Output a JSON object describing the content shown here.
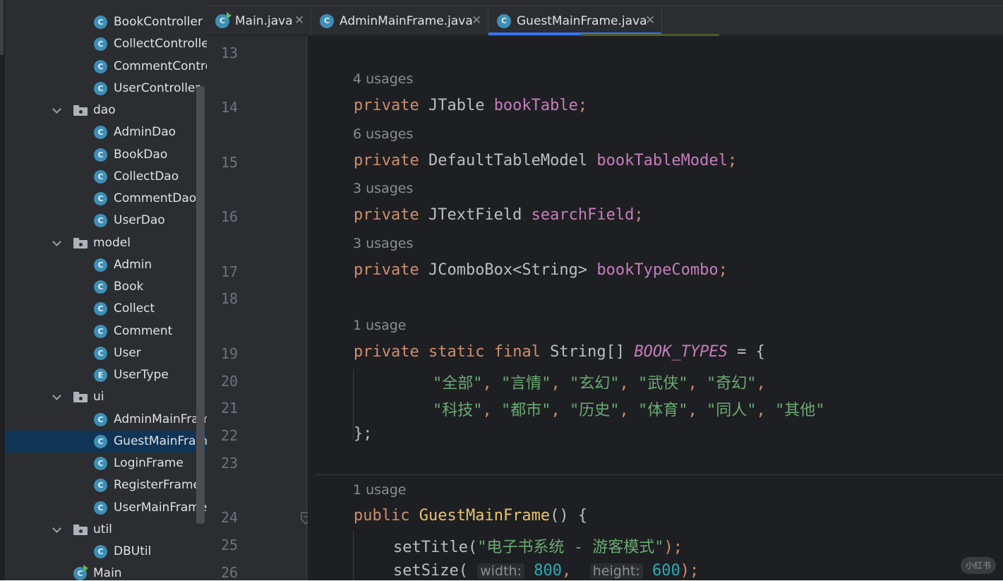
{
  "tabs": [
    {
      "label": "Main.java",
      "icon": "class-icon-main",
      "active": false
    },
    {
      "label": "AdminMainFrame.java",
      "icon": "class-icon",
      "active": false
    },
    {
      "label": "GuestMainFrame.java",
      "icon": "class-icon",
      "active": true
    }
  ],
  "tree": {
    "items": [
      {
        "label": "BookController",
        "kind": "class",
        "letter": "C"
      },
      {
        "label": "CollectControlle",
        "kind": "class",
        "letter": "C"
      },
      {
        "label": "CommentContro",
        "kind": "class",
        "letter": "C"
      },
      {
        "label": "UserController",
        "kind": "class",
        "letter": "C"
      },
      {
        "label": "dao",
        "kind": "package"
      },
      {
        "label": "AdminDao",
        "kind": "class",
        "letter": "C"
      },
      {
        "label": "BookDao",
        "kind": "class",
        "letter": "C"
      },
      {
        "label": "CollectDao",
        "kind": "class",
        "letter": "C"
      },
      {
        "label": "CommentDao",
        "kind": "class",
        "letter": "C"
      },
      {
        "label": "UserDao",
        "kind": "class",
        "letter": "C"
      },
      {
        "label": "model",
        "kind": "package"
      },
      {
        "label": "Admin",
        "kind": "class",
        "letter": "C"
      },
      {
        "label": "Book",
        "kind": "class",
        "letter": "C"
      },
      {
        "label": "Collect",
        "kind": "class",
        "letter": "C"
      },
      {
        "label": "Comment",
        "kind": "class",
        "letter": "C"
      },
      {
        "label": "User",
        "kind": "class",
        "letter": "C"
      },
      {
        "label": "UserType",
        "kind": "enum",
        "letter": "E"
      },
      {
        "label": "ui",
        "kind": "package"
      },
      {
        "label": "AdminMainFram",
        "kind": "class",
        "letter": "C"
      },
      {
        "label": "GuestMainFram",
        "kind": "class",
        "letter": "C",
        "selected": true
      },
      {
        "label": "LoginFrame",
        "kind": "class",
        "letter": "C"
      },
      {
        "label": "RegisterFrame",
        "kind": "class",
        "letter": "C"
      },
      {
        "label": "UserMainFrame",
        "kind": "class",
        "letter": "C"
      },
      {
        "label": "util",
        "kind": "package"
      },
      {
        "label": "DBUtil",
        "kind": "class",
        "letter": "C"
      },
      {
        "label": "Main",
        "kind": "main",
        "letter": "C"
      }
    ]
  },
  "editor": {
    "line_numbers": [
      "13",
      "14",
      "15",
      "16",
      "17",
      "18",
      "19",
      "20",
      "21",
      "22",
      "23",
      "24",
      "25",
      "26"
    ],
    "usages": [
      "4 usages",
      "6 usages",
      "3 usages",
      "3 usages",
      "1 usage",
      "1 usage"
    ],
    "code": {
      "l14": {
        "kw": "private",
        "type": " JTable ",
        "field": "bookTable",
        "end": ";"
      },
      "l15": {
        "kw": "private",
        "type": " DefaultTableModel ",
        "field": "bookTableModel",
        "end": ";"
      },
      "l16": {
        "kw": "private",
        "type": " JTextField ",
        "field": "searchField",
        "end": ";"
      },
      "l17": {
        "kw": "private",
        "type": " JComboBox<String> ",
        "field": "bookTypeCombo",
        "end": ";"
      },
      "l19": {
        "kw1": "private",
        "kw2": "static",
        "kw3": "final",
        "type": " String[] ",
        "const": "BOOK_TYPES",
        "end": " = {"
      },
      "l20": [
        "\"全部\"",
        "\"言情\"",
        "\"玄幻\"",
        "\"武侠\"",
        "\"奇幻\""
      ],
      "l21": [
        "\"科技\"",
        "\"都市\"",
        "\"历史\"",
        "\"体育\"",
        "\"同人\"",
        "\"其他\""
      ],
      "l22": "};",
      "l24": {
        "kw": "public",
        "fn": "GuestMainFrame",
        "end": "() {"
      },
      "l25": {
        "call": "setTitle(",
        "str": "\"电子书系统 - 游客模式\"",
        "end": ");"
      },
      "l26": {
        "call": "setSize(",
        "hint1": "width:",
        "num1": "800",
        "sep": ", ",
        "hint2": "height:",
        "num2": "600",
        "end": ");"
      }
    }
  },
  "watermark": "小红书",
  "colors": {
    "keyword": "#cf8e6d",
    "field": "#c77dbb",
    "string": "#6aab73",
    "function": "#e8c46b",
    "number": "#2aacb8",
    "selection": "#0f3456",
    "tab_underline": "#3574f0"
  }
}
